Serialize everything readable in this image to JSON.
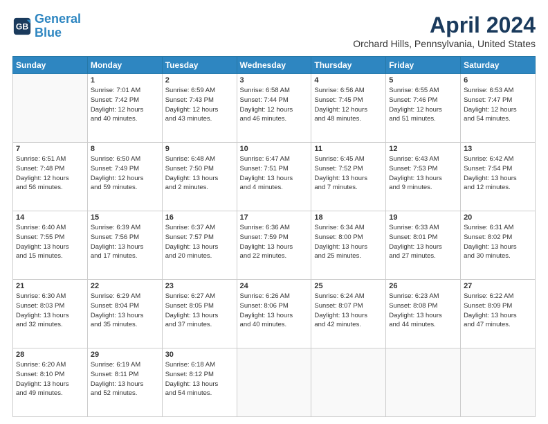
{
  "header": {
    "logo_line1": "General",
    "logo_line2": "Blue",
    "month_year": "April 2024",
    "location": "Orchard Hills, Pennsylvania, United States"
  },
  "days_of_week": [
    "Sunday",
    "Monday",
    "Tuesday",
    "Wednesday",
    "Thursday",
    "Friday",
    "Saturday"
  ],
  "weeks": [
    [
      {
        "num": "",
        "info": ""
      },
      {
        "num": "1",
        "info": "Sunrise: 7:01 AM\nSunset: 7:42 PM\nDaylight: 12 hours\nand 40 minutes."
      },
      {
        "num": "2",
        "info": "Sunrise: 6:59 AM\nSunset: 7:43 PM\nDaylight: 12 hours\nand 43 minutes."
      },
      {
        "num": "3",
        "info": "Sunrise: 6:58 AM\nSunset: 7:44 PM\nDaylight: 12 hours\nand 46 minutes."
      },
      {
        "num": "4",
        "info": "Sunrise: 6:56 AM\nSunset: 7:45 PM\nDaylight: 12 hours\nand 48 minutes."
      },
      {
        "num": "5",
        "info": "Sunrise: 6:55 AM\nSunset: 7:46 PM\nDaylight: 12 hours\nand 51 minutes."
      },
      {
        "num": "6",
        "info": "Sunrise: 6:53 AM\nSunset: 7:47 PM\nDaylight: 12 hours\nand 54 minutes."
      }
    ],
    [
      {
        "num": "7",
        "info": "Sunrise: 6:51 AM\nSunset: 7:48 PM\nDaylight: 12 hours\nand 56 minutes."
      },
      {
        "num": "8",
        "info": "Sunrise: 6:50 AM\nSunset: 7:49 PM\nDaylight: 12 hours\nand 59 minutes."
      },
      {
        "num": "9",
        "info": "Sunrise: 6:48 AM\nSunset: 7:50 PM\nDaylight: 13 hours\nand 2 minutes."
      },
      {
        "num": "10",
        "info": "Sunrise: 6:47 AM\nSunset: 7:51 PM\nDaylight: 13 hours\nand 4 minutes."
      },
      {
        "num": "11",
        "info": "Sunrise: 6:45 AM\nSunset: 7:52 PM\nDaylight: 13 hours\nand 7 minutes."
      },
      {
        "num": "12",
        "info": "Sunrise: 6:43 AM\nSunset: 7:53 PM\nDaylight: 13 hours\nand 9 minutes."
      },
      {
        "num": "13",
        "info": "Sunrise: 6:42 AM\nSunset: 7:54 PM\nDaylight: 13 hours\nand 12 minutes."
      }
    ],
    [
      {
        "num": "14",
        "info": "Sunrise: 6:40 AM\nSunset: 7:55 PM\nDaylight: 13 hours\nand 15 minutes."
      },
      {
        "num": "15",
        "info": "Sunrise: 6:39 AM\nSunset: 7:56 PM\nDaylight: 13 hours\nand 17 minutes."
      },
      {
        "num": "16",
        "info": "Sunrise: 6:37 AM\nSunset: 7:57 PM\nDaylight: 13 hours\nand 20 minutes."
      },
      {
        "num": "17",
        "info": "Sunrise: 6:36 AM\nSunset: 7:59 PM\nDaylight: 13 hours\nand 22 minutes."
      },
      {
        "num": "18",
        "info": "Sunrise: 6:34 AM\nSunset: 8:00 PM\nDaylight: 13 hours\nand 25 minutes."
      },
      {
        "num": "19",
        "info": "Sunrise: 6:33 AM\nSunset: 8:01 PM\nDaylight: 13 hours\nand 27 minutes."
      },
      {
        "num": "20",
        "info": "Sunrise: 6:31 AM\nSunset: 8:02 PM\nDaylight: 13 hours\nand 30 minutes."
      }
    ],
    [
      {
        "num": "21",
        "info": "Sunrise: 6:30 AM\nSunset: 8:03 PM\nDaylight: 13 hours\nand 32 minutes."
      },
      {
        "num": "22",
        "info": "Sunrise: 6:29 AM\nSunset: 8:04 PM\nDaylight: 13 hours\nand 35 minutes."
      },
      {
        "num": "23",
        "info": "Sunrise: 6:27 AM\nSunset: 8:05 PM\nDaylight: 13 hours\nand 37 minutes."
      },
      {
        "num": "24",
        "info": "Sunrise: 6:26 AM\nSunset: 8:06 PM\nDaylight: 13 hours\nand 40 minutes."
      },
      {
        "num": "25",
        "info": "Sunrise: 6:24 AM\nSunset: 8:07 PM\nDaylight: 13 hours\nand 42 minutes."
      },
      {
        "num": "26",
        "info": "Sunrise: 6:23 AM\nSunset: 8:08 PM\nDaylight: 13 hours\nand 44 minutes."
      },
      {
        "num": "27",
        "info": "Sunrise: 6:22 AM\nSunset: 8:09 PM\nDaylight: 13 hours\nand 47 minutes."
      }
    ],
    [
      {
        "num": "28",
        "info": "Sunrise: 6:20 AM\nSunset: 8:10 PM\nDaylight: 13 hours\nand 49 minutes."
      },
      {
        "num": "29",
        "info": "Sunrise: 6:19 AM\nSunset: 8:11 PM\nDaylight: 13 hours\nand 52 minutes."
      },
      {
        "num": "30",
        "info": "Sunrise: 6:18 AM\nSunset: 8:12 PM\nDaylight: 13 hours\nand 54 minutes."
      },
      {
        "num": "",
        "info": ""
      },
      {
        "num": "",
        "info": ""
      },
      {
        "num": "",
        "info": ""
      },
      {
        "num": "",
        "info": ""
      }
    ]
  ]
}
